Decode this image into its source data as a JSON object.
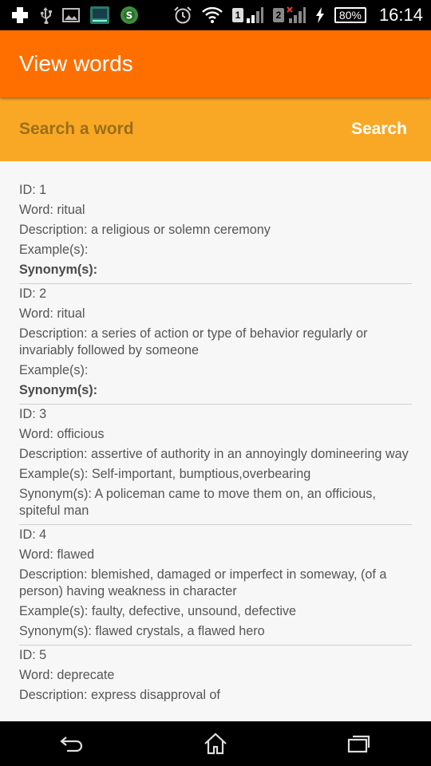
{
  "status_bar": {
    "sim1": "1",
    "sim2": "2",
    "battery": "80%",
    "time": "16:14"
  },
  "app_bar": {
    "title": "View words"
  },
  "search": {
    "placeholder": "Search a word",
    "button_label": "Search"
  },
  "entries": [
    {
      "id": "ID: 1",
      "word": "Word: ritual",
      "description": "Description: a religious or solemn ceremony",
      "examples": "Example(s):",
      "synonyms": "Synonym(s):"
    },
    {
      "id": "ID: 2",
      "word": "Word: ritual",
      "description": "Description: a series of action or type of behavior regularly or invariably followed by someone",
      "examples": "Example(s):",
      "synonyms": "Synonym(s):"
    },
    {
      "id": "ID: 3",
      "word": "Word: officious",
      "description": "Description: assertive of authority in an annoyingly domineering way",
      "examples": "Example(s): Self-important, bumptious,overbearing",
      "synonyms": "Synonym(s): A policeman came to move them on, an officious, spiteful man"
    },
    {
      "id": "ID: 4",
      "word": "Word: flawed",
      "description": "Description: blemished, damaged or imperfect in someway, (of a person) having weakness in character",
      "examples": "Example(s): faulty, defective, unsound, defective",
      "synonyms": "Synonym(s): flawed crystals, a flawed hero"
    },
    {
      "id": "ID: 5",
      "word": "Word: deprecate",
      "description": "Description: express disapproval of"
    }
  ]
}
